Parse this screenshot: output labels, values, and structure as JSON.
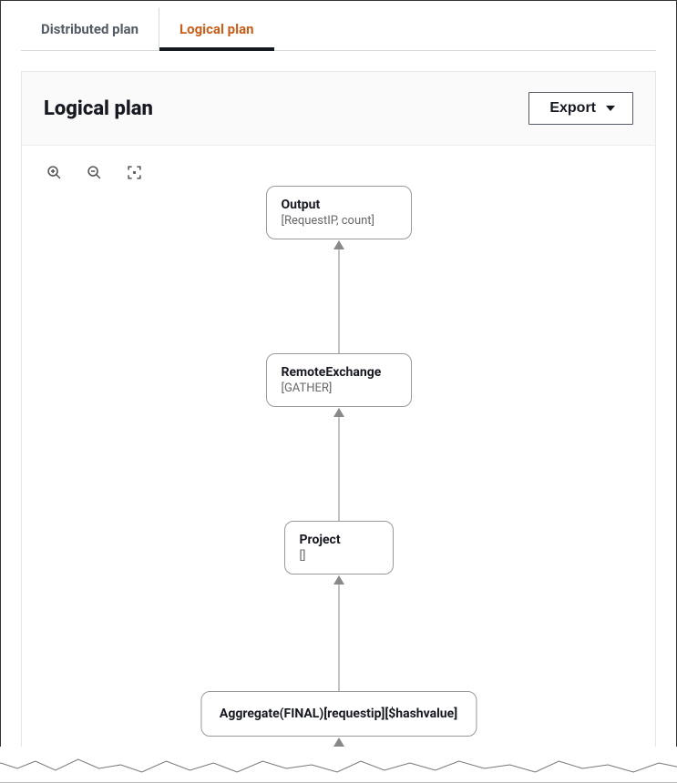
{
  "tabs": {
    "distributed": "Distributed plan",
    "logical": "Logical plan"
  },
  "panel": {
    "title": "Logical plan",
    "export_label": "Export"
  },
  "toolbar": {
    "zoom_in": "zoom-in",
    "zoom_out": "zoom-out",
    "fit": "fit-screen"
  },
  "nodes": {
    "output": {
      "title": "Output",
      "sub": "[RequestIP, count]"
    },
    "remote_exchange": {
      "title": "RemoteExchange",
      "sub": "[GATHER]"
    },
    "project": {
      "title": "Project",
      "sub": "[]"
    },
    "aggregate": {
      "title": "Aggregate(FINAL)[requestip][$hashvalue]"
    }
  }
}
